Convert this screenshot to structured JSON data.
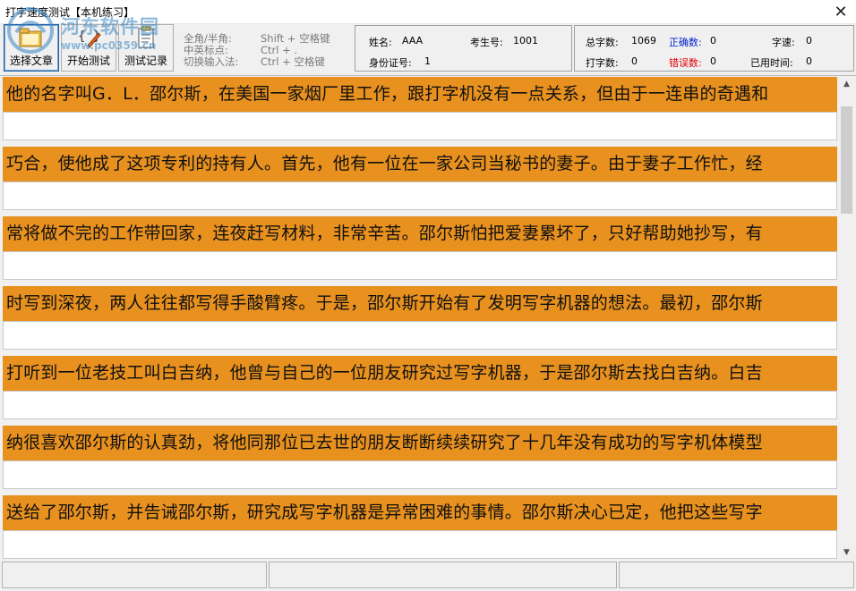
{
  "window": {
    "title": "打字速度测试【本机练习】"
  },
  "watermark": {
    "brand": "河东软件园",
    "url": "www.pc0359.cn"
  },
  "toolbar": {
    "buttons": [
      {
        "label": "选择文章",
        "icon": "folder-icon",
        "selected": true
      },
      {
        "label": "开始测试",
        "icon": "edit-icon",
        "selected": false
      },
      {
        "label": "测试记录",
        "icon": "record-icon",
        "selected": false
      }
    ],
    "hints": [
      {
        "key": "全角/半角:",
        "value": "Shift + 空格键"
      },
      {
        "key": "中英标点:",
        "value": "Ctrl + ."
      },
      {
        "key": "切换输入法:",
        "value": "Ctrl + 空格键"
      }
    ]
  },
  "user_info": {
    "name_label": "姓名:",
    "name_value": "AAA",
    "exam_no_label": "考生号:",
    "exam_no_value": "1001",
    "id_label": "身份证号:",
    "id_value": "1"
  },
  "stats": {
    "total_label": "总字数:",
    "total_value": "1069",
    "correct_label": "正确数:",
    "correct_value": "0",
    "speed_label": "字速:",
    "speed_value": "0",
    "typed_label": "打字数:",
    "typed_value": "0",
    "wrong_label": "错误数:",
    "wrong_value": "0",
    "time_label": "已用时间:",
    "time_value": "0"
  },
  "colors": {
    "source_line_bg": "#e8911f",
    "correct_label": "#0022cc",
    "wrong_label": "#e00000"
  },
  "lines": [
    "他的名字叫G．L．邵尔斯，在美国一家烟厂里工作，跟打字机没有一点关系，但由于一连串的奇遇和",
    "巧合，使他成了这项专利的持有人。首先，他有一位在一家公司当秘书的妻子。由于妻子工作忙，经",
    "常将做不完的工作带回家，连夜赶写材料，非常辛苦。邵尔斯怕把爱妻累坏了，只好帮助她抄写，有",
    "时写到深夜，两人往往都写得手酸臂疼。于是，邵尔斯开始有了发明写字机器的想法。最初，邵尔斯",
    "打听到一位老技工叫白吉纳，他曾与自己的一位朋友研究过写字机器，于是邵尔斯去找白吉纳。白吉",
    "纳很喜欢邵尔斯的认真劲，将他同那位已去世的朋友断断续续研究了十几年没有成功的写字机体模型",
    "送给了邵尔斯，并告诫邵尔斯，研究成写字机器是异常困难的事情。邵尔斯决心已定，他把这些写字"
  ],
  "statusbar": {
    "panes": [
      "",
      "",
      ""
    ]
  }
}
